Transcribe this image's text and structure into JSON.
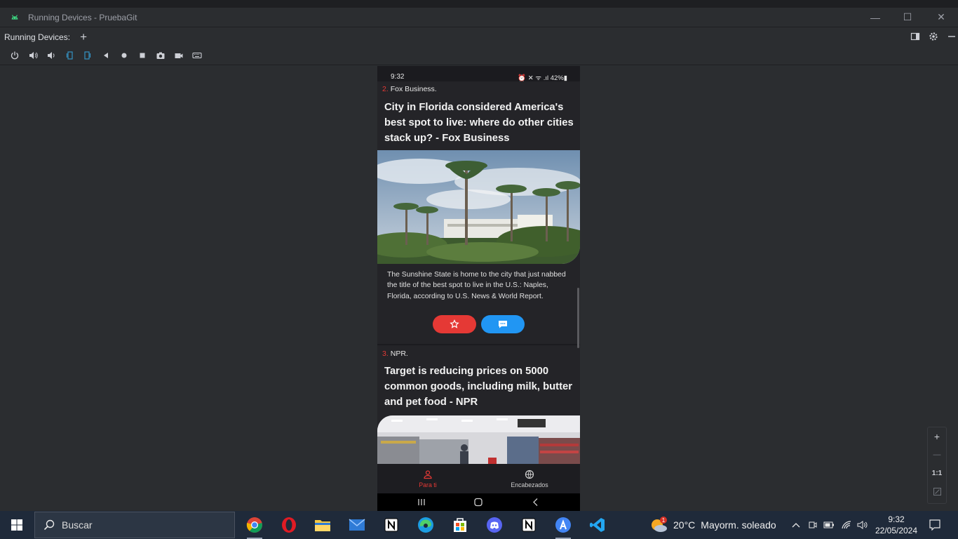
{
  "window": {
    "title": "Running Devices - PruebaGit",
    "minimize_glyph": "—",
    "maximize_glyph": "☐",
    "close_glyph": "✕"
  },
  "panel": {
    "label": "Running Devices:",
    "add_glyph": "+"
  },
  "toolbar": {
    "icons": [
      "power-icon",
      "volume-up-icon",
      "volume-down-icon",
      "rotate-left-icon",
      "rotate-right-icon",
      "back-icon",
      "home-icon",
      "overview-icon",
      "screenshot-icon",
      "screen-record-icon",
      "keyboard-icon"
    ]
  },
  "phone": {
    "status": {
      "time": "9:32",
      "right": "⏰ ✕ ᯤ .ıl 42%▮"
    },
    "articles": [
      {
        "num": "2.",
        "source": "Fox Business.",
        "headline": "City in Florida considered America's best spot to live: where do other cities stack up? - Fox Business",
        "description": "The Sunshine State is home to the city that just nabbed the title of the best spot to live in the U.S.: Naples, Florida, according to U.S. News & World Report."
      },
      {
        "num": "3.",
        "source": "NPR.",
        "headline": "Target is reducing prices on 5000 common goods, including milk, butter and pet food - NPR"
      }
    ],
    "bottom_nav": {
      "para_ti": "Para ti",
      "encabezados": "Encabezados"
    },
    "colors": {
      "accent_red": "#e53935",
      "accent_blue": "#2196f3"
    }
  },
  "zoom": {
    "zoom_in": "+",
    "zoom_out": "—",
    "actual": "1:1"
  },
  "taskbar": {
    "search_text": "Buscar",
    "weather_temp": "20°C",
    "weather_desc": "Mayorm. soleado",
    "weather_badge": "1",
    "time": "9:32",
    "date": "22/05/2024"
  }
}
